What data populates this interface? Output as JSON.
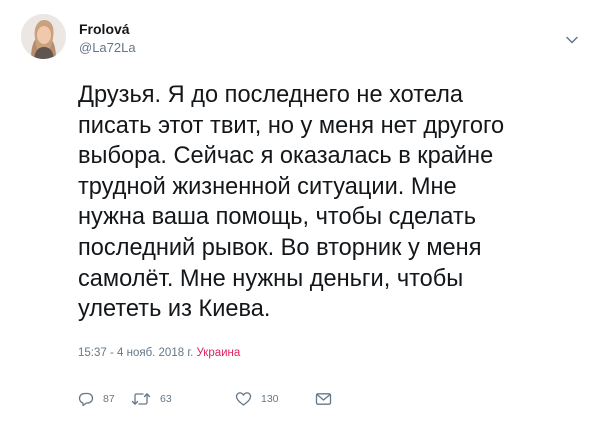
{
  "user": {
    "name": "Frolová",
    "handle": "@La72La",
    "avatar_icon": "profile-photo"
  },
  "tweet": {
    "text": "Друзья. Я до последнего не хотела\nписать этот твит, но у меня нет другого\nвыбора. Сейчас я оказалась в крайне\nтрудной жизненной ситуации. Мне\nнужна ваша помощь, чтобы сделать\nпоследний рывок. Во вторник у меня\nсамолёт. Мне нужны деньги, чтобы\nулететь из Киева.",
    "timestamp": "15:37 - 4 нояб. 2018 г.",
    "location": "Украина"
  },
  "actions": {
    "replies": "87",
    "retweets": "63",
    "likes": "130"
  },
  "icons": {
    "caret": "chevron-down-icon",
    "reply": "reply-icon",
    "retweet": "retweet-icon",
    "like": "heart-icon",
    "dm": "envelope-icon"
  },
  "colors": {
    "text": "#14171a",
    "secondary": "#657786",
    "location": "#e0245e"
  }
}
